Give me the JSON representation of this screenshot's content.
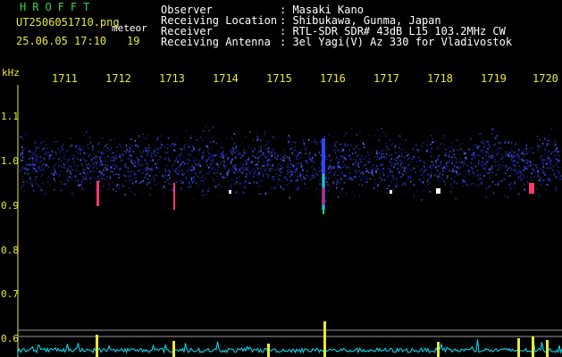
{
  "header": {
    "title": "HROFFT",
    "filename": "UT2506051710.png",
    "tag": "meteor",
    "datetime": "25.06.05 17:10",
    "number": "19"
  },
  "info": {
    "rows": [
      {
        "label": "Observer",
        "value": ": Masaki Kano"
      },
      {
        "label": "Receiving Location",
        "value": ": Shibukawa, Gunma, Japan"
      },
      {
        "label": "Receiver",
        "value": ": RTL-SDR SDR# 43dB L15 103.2MHz CW"
      },
      {
        "label": "Receiving Antenna",
        "value": ": 3el Yagi(V) Az 330 for Vladivostok"
      }
    ]
  },
  "axis": {
    "unit": "kHz",
    "x_ticks": [
      "1711",
      "1712",
      "1713",
      "1714",
      "1715",
      "1716",
      "1717",
      "1718",
      "1719",
      "1720"
    ],
    "y_ticks": [
      "1.1",
      "1.0",
      "0.9",
      "0.8",
      "0.7",
      "0.6"
    ]
  },
  "colors": {
    "background": "#000000",
    "title_green": "#2fdc3a",
    "axis_yellow": "#e8e83a",
    "noise_blue": "#2a3cff",
    "trace_cyan": "#00e5ff"
  }
}
